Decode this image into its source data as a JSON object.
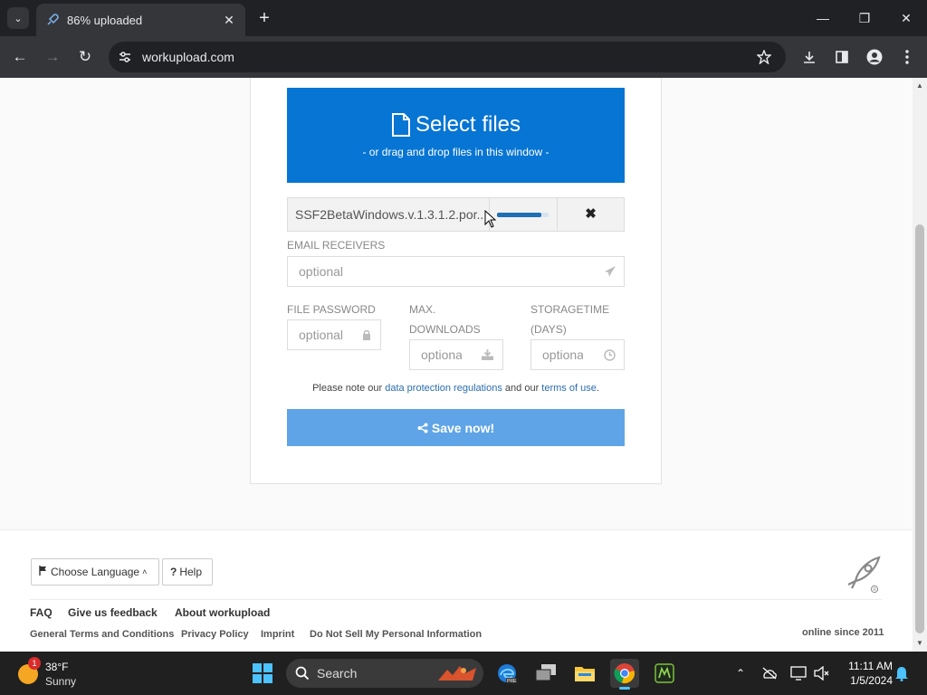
{
  "browser": {
    "tab_title": "86% uploaded",
    "url": "workupload.com"
  },
  "upload": {
    "select_title": "Select files",
    "select_subtitle": "- or drag and drop files in this window -",
    "file_name": "SSF2BetaWindows.v.1.3.1.2.por...",
    "progress": 0.86
  },
  "form": {
    "email_label": "EMAIL RECEIVERS",
    "email_placeholder": "optional",
    "password_label": "FILE PASSWORD",
    "password_placeholder": "optional",
    "max_label_1": "MAX.",
    "max_label_2": "DOWNLOADS",
    "max_placeholder": "optional",
    "storage_label_1": "STORAGETIME",
    "storage_label_2": "(DAYS)",
    "storage_placeholder": "optional"
  },
  "note": {
    "prefix": "Please note our ",
    "link1": "data protection regulations",
    "middle": " and our ",
    "link2": "terms of use",
    "suffix": "."
  },
  "save_label": "Save now!",
  "footer": {
    "language_label": "Choose Language",
    "help_label": "Help",
    "nav": [
      "FAQ",
      "Give us feedback",
      "About workupload"
    ],
    "links": [
      "General Terms and Conditions",
      "Privacy Policy",
      "Imprint",
      "Do Not Sell My Personal Information"
    ],
    "online_since": "online since 2011"
  },
  "taskbar": {
    "weather_temp": "38°F",
    "weather_condition": "Sunny",
    "weather_badge": "1",
    "search_label": "Search",
    "time": "11:11 AM",
    "date": "1/5/2024"
  },
  "colors": {
    "accent": "#0775d3",
    "save_button": "#5fa4e6",
    "link": "#2a6db0"
  }
}
